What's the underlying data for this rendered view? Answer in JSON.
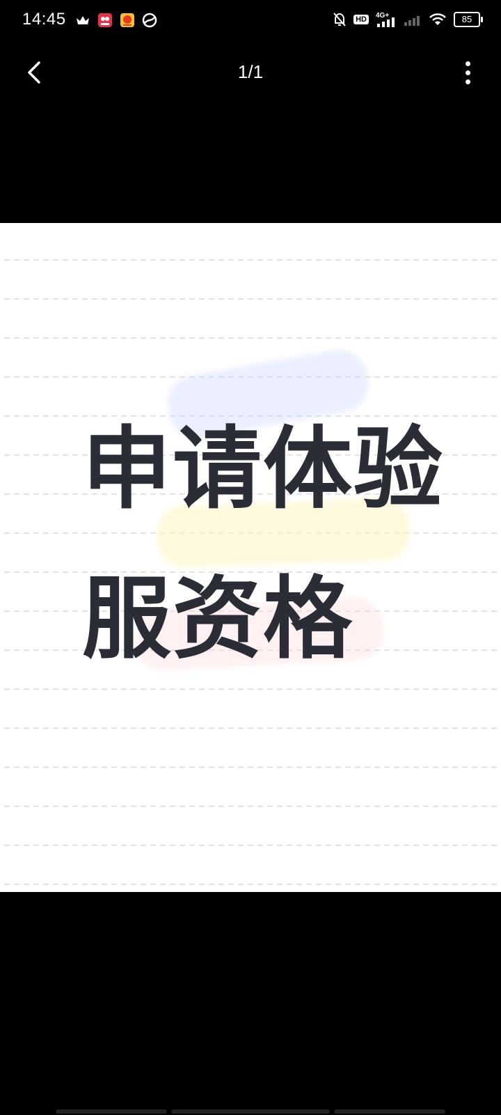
{
  "status_bar": {
    "time": "14:45",
    "left_icons": [
      "crown-icon",
      "app-icon-red",
      "app-icon-orange",
      "app-icon-swirl"
    ],
    "right_icons": [
      "bell-off-icon",
      "hd-icon",
      "signal-4g-icon",
      "signal-icon",
      "wifi-icon"
    ],
    "hd_label": "HD",
    "network_label": "4G+",
    "battery": "85"
  },
  "nav": {
    "page_counter": "1/1",
    "back_icon": "chevron-left-icon",
    "more_icon": "more-vertical-icon"
  },
  "image": {
    "line1": "申请体验",
    "line2": "服资格"
  },
  "colors": {
    "background": "#000000",
    "text_dark": "#2b2d36",
    "white": "#ffffff"
  }
}
